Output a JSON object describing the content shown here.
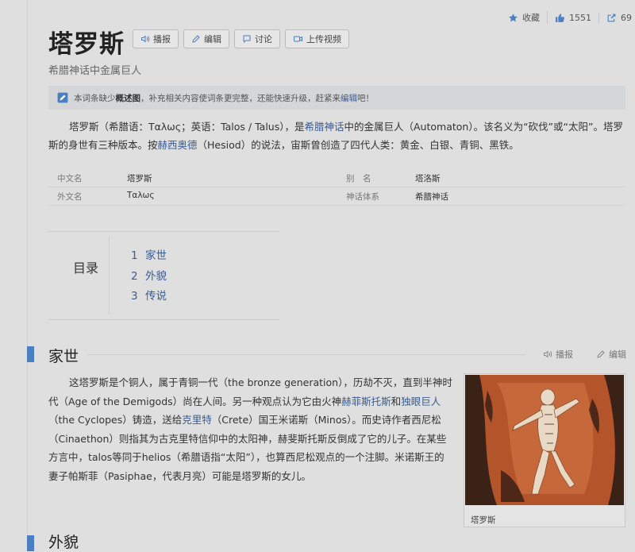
{
  "header": {
    "stats": {
      "favorite_label": "收藏",
      "likes": "1551",
      "shares": "69"
    }
  },
  "entry": {
    "title": "塔罗斯",
    "actions": {
      "listen": "播报",
      "edit": "编辑",
      "discuss": "讨论",
      "upload_video": "上传视频"
    },
    "subtitle": "希腊神话中金属巨人"
  },
  "notice": {
    "prefix": "本词条缺少",
    "bold": "概述图",
    "middle": "，补充相关内容使词条更完整，还能快速升级，赶紧来",
    "link": "编辑",
    "suffix": "吧！"
  },
  "summary": {
    "s1": "塔罗斯（希腊语：Ταλως；英语：Talos / Talus），是",
    "link1": "希腊神话",
    "s2": "中的金属巨人（Automaton）。该名义为“砍伐”或“太阳”。塔罗斯的身世有三种版本。按",
    "link2": "赫西奥德",
    "s3": "（Hesiod）的说法，宙斯曾创造了四代人类：黄金、白银、青铜、黑铁。"
  },
  "basic_info": [
    {
      "k1": "中文名",
      "v1": "塔罗斯",
      "k2": "别　名",
      "v2": "塔洛斯"
    },
    {
      "k1": "外文名",
      "v1": "Ταλως",
      "k2": "神话体系",
      "v2": "希腊神话"
    }
  ],
  "toc": {
    "title": "目录",
    "items": [
      {
        "num": "1",
        "label": "家世"
      },
      {
        "num": "2",
        "label": "外貌"
      },
      {
        "num": "3",
        "label": "传说"
      }
    ]
  },
  "section1": {
    "title": "家世",
    "listen": "播报",
    "edit": "编辑",
    "t1": "这塔罗斯是个铜人，属于青铜一代（the bronze generation），历劫不灭，直到半神时代（Age of the Demigods）尚在人间。另一种观点认为它由火神",
    "l1": "赫菲斯托斯",
    "t2": "和",
    "l2": "独眼巨人",
    "t3": "（the Cyclopes）铸造，送给",
    "l3": "克里特",
    "t4": "（Crete）国王米诺斯（Minos）。而史诗作者西尼松（Cinaethon）则指其为古克里特信仰中的太阳神，赫斐斯托斯反倒成了它的儿子。在某些方言中，talos等同于helios（希腊语指“太阳”），也算西尼松观点的一个注脚。米诺斯王的妻子帕斯菲（Pasiphae，代表月亮）可能是塔罗斯的女儿。",
    "figure_caption": "塔罗斯"
  },
  "section2": {
    "title": "外貌"
  },
  "colors": {
    "link": "#3a5c94",
    "accent": "#4a7fc1",
    "background": "#dfdfdf"
  }
}
